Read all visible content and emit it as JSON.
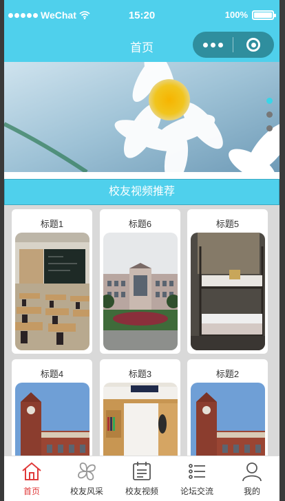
{
  "status_bar": {
    "carrier": "WeChat",
    "time": "15:20",
    "battery": "100%"
  },
  "nav": {
    "title": "首页"
  },
  "banner": {
    "active_index": 0,
    "count": 3
  },
  "section": {
    "title": "校友视频推荐"
  },
  "cards": [
    {
      "title": "标题1",
      "image": "classroom"
    },
    {
      "title": "标题6",
      "image": "campus-building"
    },
    {
      "title": "标题5",
      "image": "dorm-bunk"
    },
    {
      "title": "标题4",
      "image": "clock-tower"
    },
    {
      "title": "标题3",
      "image": "dorm-desk"
    },
    {
      "title": "标题2",
      "image": "clock-tower"
    }
  ],
  "tabs": [
    {
      "label": "首页",
      "icon": "home-icon",
      "active": true
    },
    {
      "label": "校友风采",
      "icon": "clover-icon",
      "active": false
    },
    {
      "label": "校友视频",
      "icon": "video-board-icon",
      "active": false
    },
    {
      "label": "论坛交流",
      "icon": "list-icon",
      "active": false
    },
    {
      "label": "我的",
      "icon": "user-icon",
      "active": false
    }
  ],
  "colors": {
    "primary": "#4fd0ec",
    "capsule": "#2f8e9e",
    "active_tab": "#e03a3a"
  }
}
